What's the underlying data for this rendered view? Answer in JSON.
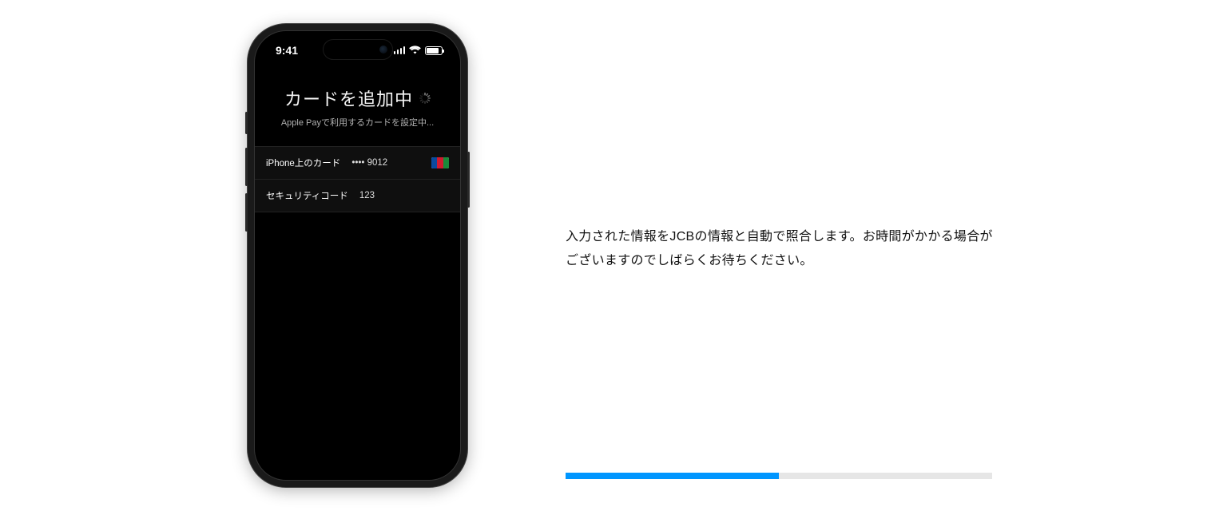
{
  "phone": {
    "status_bar": {
      "time": "9:41"
    },
    "screen": {
      "title": "カードを追加中",
      "subtitle": "Apple Payで利用するカードを設定中...",
      "rows": [
        {
          "label": "iPhone上のカード",
          "value": "•••• 9012",
          "brand": "jcb"
        },
        {
          "label": "セキュリティコード",
          "value": "123"
        }
      ]
    }
  },
  "description": "入力された情報をJCBの情報と自動で照合します。お時間がかかる場合がございますのでしばらくお待ちください。",
  "progress": {
    "percent": 50
  }
}
